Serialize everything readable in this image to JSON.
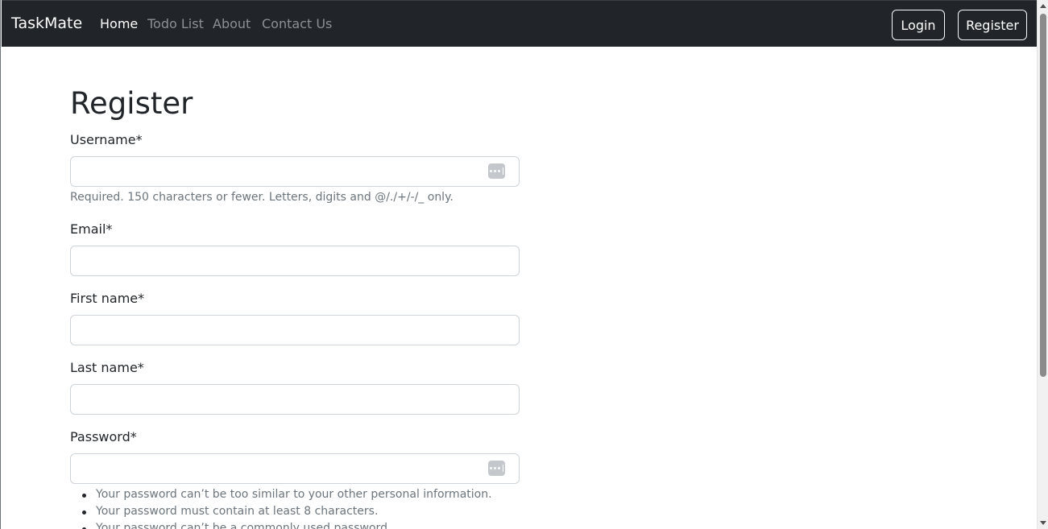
{
  "navbar": {
    "brand": "TaskMate",
    "links": [
      {
        "label": "Home",
        "active": true
      },
      {
        "label": "Todo List",
        "active": false
      },
      {
        "label": "About",
        "active": false
      },
      {
        "label": "Contact Us",
        "active": false
      }
    ],
    "login_label": "Login",
    "register_label": "Register"
  },
  "form": {
    "title": "Register",
    "username": {
      "label": "Username*",
      "value": "",
      "help": "Required. 150 characters or fewer. Letters, digits and @/./+/-/_ only."
    },
    "email": {
      "label": "Email*",
      "value": ""
    },
    "first_name": {
      "label": "First name*",
      "value": ""
    },
    "last_name": {
      "label": "Last name*",
      "value": ""
    },
    "password": {
      "label": "Password*",
      "value": "",
      "help_items": [
        "Your password can’t be too similar to your other personal information.",
        "Your password must contain at least 8 characters.",
        "Your password can’t be a commonly used password."
      ]
    }
  },
  "icons": {
    "password_manager": "password-manager-icon"
  },
  "colors": {
    "navbar_bg": "#212529",
    "nav_link_inactive": "#8c9096",
    "help_text": "#6c757d"
  }
}
